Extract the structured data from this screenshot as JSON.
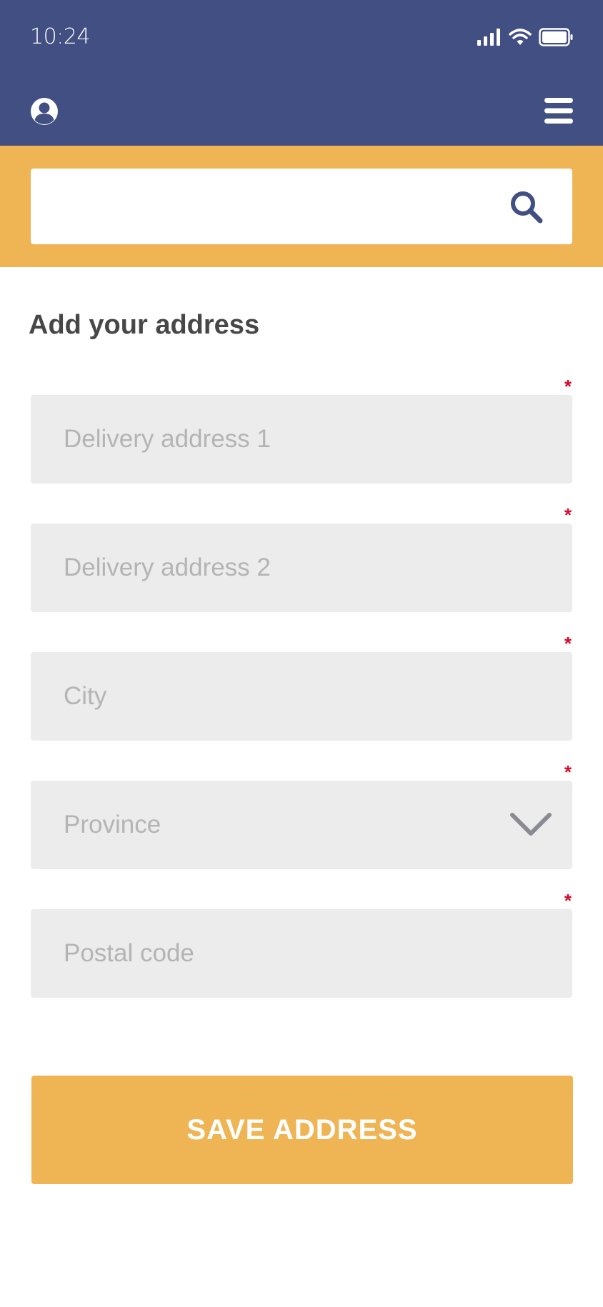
{
  "status_bar": {
    "time": "10:24"
  },
  "colors": {
    "header_bg": "#414f82",
    "accent": "#efb454",
    "field_bg": "#ececec",
    "placeholder": "#b4b4b4",
    "required": "#d4082a",
    "title": "#474747"
  },
  "header": {
    "left_icon": "user-circle-icon",
    "right_icon": "hamburger-menu-icon"
  },
  "search": {
    "placeholder": "",
    "value": "",
    "icon": "search-icon"
  },
  "form": {
    "title": "Add your address",
    "required_marker": "*",
    "fields": [
      {
        "placeholder": "Delivery address 1",
        "required": true
      },
      {
        "placeholder": "Delivery address 2",
        "required": true
      },
      {
        "placeholder": "City",
        "required": true
      },
      {
        "placeholder": "Province",
        "required": true,
        "type": "select",
        "icon": "chevron-down-icon"
      },
      {
        "placeholder": "Postal code",
        "required": true
      }
    ],
    "submit_label": "SAVE ADDRESS"
  }
}
